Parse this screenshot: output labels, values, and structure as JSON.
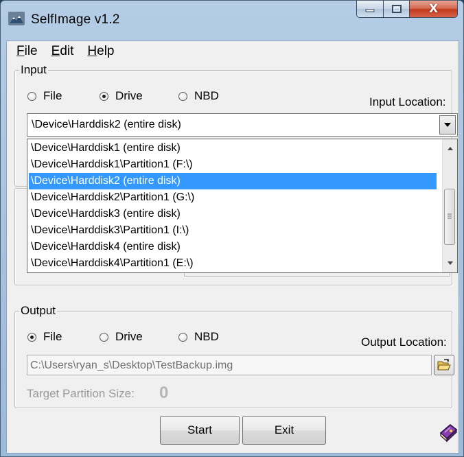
{
  "window": {
    "title": "SelfImage v1.2",
    "close_glyph": "X"
  },
  "menu": [
    {
      "first": "F",
      "rest": "ile"
    },
    {
      "first": "E",
      "rest": "dit"
    },
    {
      "first": "H",
      "rest": "elp"
    }
  ],
  "input": {
    "group_label": "Input",
    "radios": [
      {
        "label": "File",
        "checked": false
      },
      {
        "label": "Drive",
        "checked": true
      },
      {
        "label": "NBD",
        "checked": false
      }
    ],
    "location_label": "Input Location:",
    "selected_value": "\\Device\\Harddisk2 (entire disk)",
    "options": [
      "\\Device\\Harddisk1 (entire disk)",
      "\\Device\\Harddisk1\\Partition1 (F:\\)",
      "\\Device\\Harddisk2 (entire disk)",
      "\\Device\\Harddisk2\\Partition1 (G:\\)",
      "\\Device\\Harddisk3 (entire disk)",
      "\\Device\\Harddisk3\\Partition1 (I:\\)",
      "\\Device\\Harddisk4 (entire disk)",
      "\\Device\\Harddisk4\\Partition1 (E:\\)"
    ],
    "highlighted_index": 2
  },
  "output": {
    "group_label": "Output",
    "radios": [
      {
        "label": "File",
        "checked": true
      },
      {
        "label": "Drive",
        "checked": false
      },
      {
        "label": "NBD",
        "checked": false
      }
    ],
    "location_label": "Output Location:",
    "path_value": "C:\\Users\\ryan_s\\Desktop\\TestBackup.img",
    "target_size_label": "Target Partition Size:",
    "target_size_value": "0"
  },
  "buttons": {
    "start": "Start",
    "exit": "Exit"
  },
  "icons": {
    "app": "selfimage-app-icon",
    "browse": "open-folder-icon",
    "about": "book-icon",
    "minimize": "minimize-icon",
    "maximize": "maximize-icon",
    "close": "close-icon"
  },
  "colors": {
    "selection": "#3399ff",
    "close_button": "#c2391b",
    "title_bar": "#b9d1ea"
  }
}
